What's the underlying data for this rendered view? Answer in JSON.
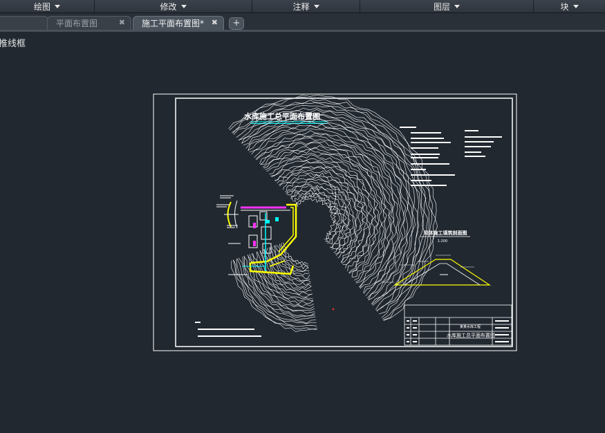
{
  "ribbon": {
    "items": [
      {
        "label": "绘图"
      },
      {
        "label": "修改"
      },
      {
        "label": "注释"
      },
      {
        "label": "图层"
      },
      {
        "label": "块"
      }
    ]
  },
  "tabs": [
    {
      "label": "平面布置图",
      "active": false
    },
    {
      "label": "施工平面布置图*",
      "active": true
    }
  ],
  "tab_close_glyph": "✖",
  "tab_add_glyph": "+",
  "viewport": {
    "label": "推线框"
  },
  "drawing": {
    "title": "水库施工总平面布置图",
    "section_title": "坝体施工填筑剖面图",
    "section_scale": "1:200",
    "title_block": {
      "project": "某某水库工程",
      "drawing_name": "水库施工总平面布置图"
    }
  },
  "colors": {
    "background": "#212830",
    "linework": "#ffffff",
    "road": "#ffff00",
    "highlight": "#00ffff",
    "magenta": "#ff33ff"
  }
}
